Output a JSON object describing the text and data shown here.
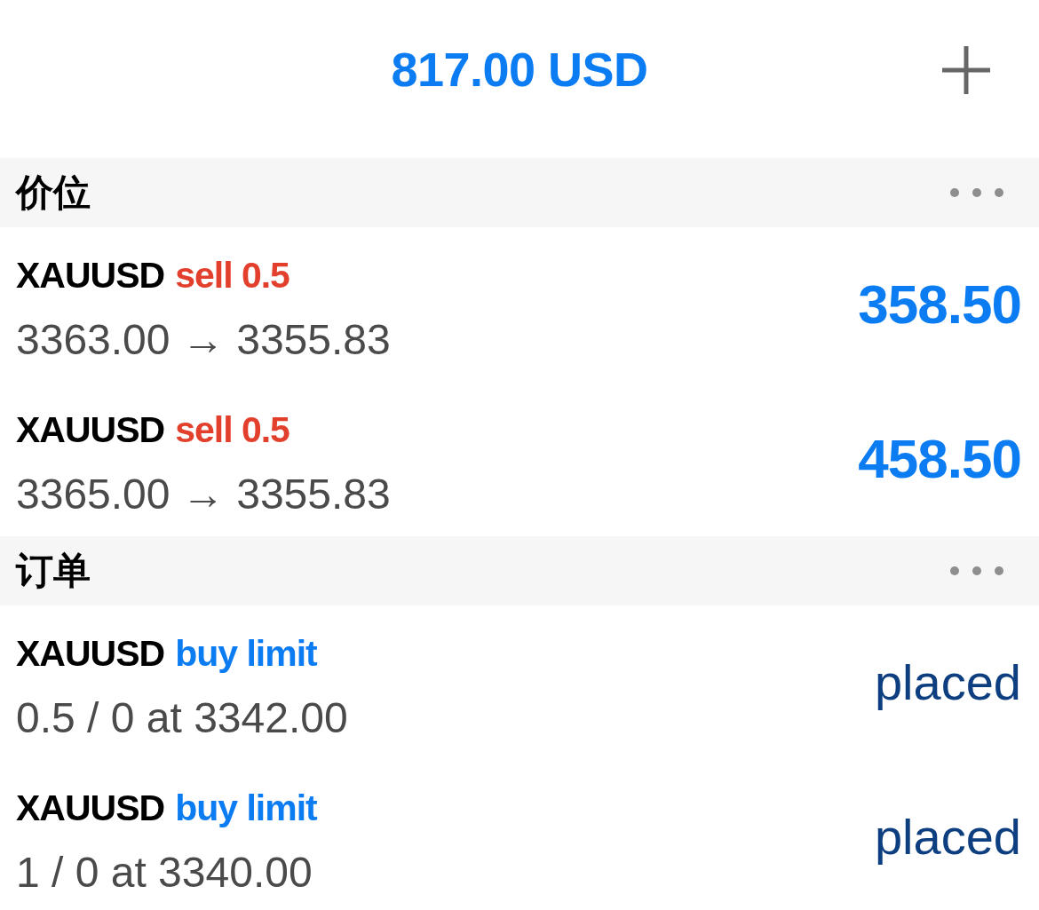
{
  "header": {
    "balance": "817.00 USD"
  },
  "sections": [
    {
      "title": "价位",
      "items": [
        {
          "kind": "position",
          "symbol": "XAUUSD",
          "order_type": "sell 0.5",
          "color": "#e23f2d",
          "prices": "3363.00 → 3355.83",
          "value": "358.50"
        },
        {
          "kind": "position",
          "symbol": "XAUUSD",
          "order_type": "sell 0.5",
          "color": "#e23f2d",
          "prices": "3365.00 → 3355.83",
          "value": "458.50"
        }
      ]
    },
    {
      "title": "订单",
      "items": [
        {
          "kind": "order",
          "symbol": "XAUUSD",
          "order_type": "buy limit",
          "color": "#0c7cf2",
          "prices": "0.5 / 0 at 3342.00",
          "value": "placed"
        },
        {
          "kind": "order",
          "symbol": "XAUUSD",
          "order_type": "buy limit",
          "color": "#0c7cf2",
          "prices": "1 / 0 at 3340.00",
          "value": "placed"
        }
      ]
    }
  ]
}
